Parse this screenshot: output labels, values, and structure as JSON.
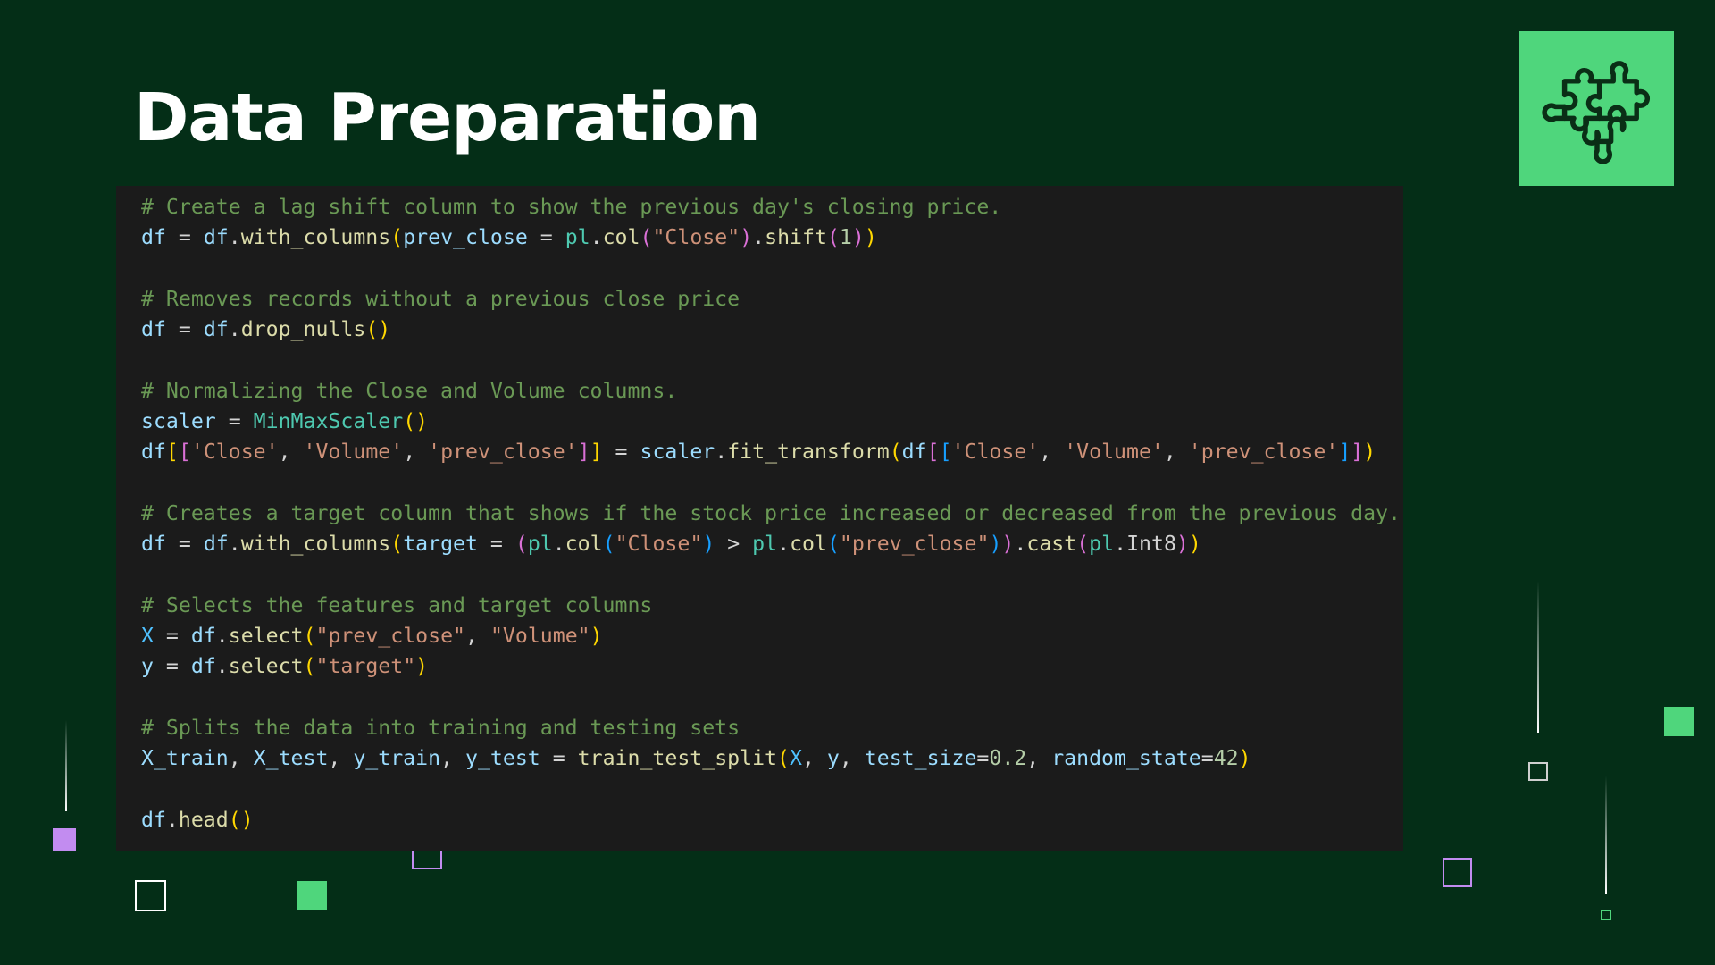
{
  "slide": {
    "title": "Data Preparation",
    "icon": "puzzle-pieces-icon"
  },
  "colors": {
    "background": "#042e17",
    "accent_green": "#4fd67c",
    "accent_purple": "#c28cf0",
    "code_bg": "#1b1b1b"
  },
  "code": {
    "language": "python",
    "lines": [
      [
        {
          "t": "# Create a lag shift column to show the previous day's closing price.",
          "k": "c"
        }
      ],
      [
        {
          "t": "df",
          "k": "v"
        },
        {
          "t": " = ",
          "k": "o"
        },
        {
          "t": "df",
          "k": "v"
        },
        {
          "t": ".",
          "k": "o"
        },
        {
          "t": "with_columns",
          "k": "f"
        },
        {
          "t": "(",
          "k": "b1"
        },
        {
          "t": "prev_close",
          "k": "v"
        },
        {
          "t": " = ",
          "k": "o"
        },
        {
          "t": "pl",
          "k": "cl"
        },
        {
          "t": ".",
          "k": "o"
        },
        {
          "t": "col",
          "k": "f"
        },
        {
          "t": "(",
          "k": "b2"
        },
        {
          "t": "\"Close\"",
          "k": "s"
        },
        {
          "t": ")",
          "k": "b2"
        },
        {
          "t": ".",
          "k": "o"
        },
        {
          "t": "shift",
          "k": "f"
        },
        {
          "t": "(",
          "k": "b2"
        },
        {
          "t": "1",
          "k": "n"
        },
        {
          "t": ")",
          "k": "b2"
        },
        {
          "t": ")",
          "k": "b1"
        }
      ],
      [],
      [
        {
          "t": "# Removes records without a previous close price",
          "k": "c"
        }
      ],
      [
        {
          "t": "df",
          "k": "v"
        },
        {
          "t": " = ",
          "k": "o"
        },
        {
          "t": "df",
          "k": "v"
        },
        {
          "t": ".",
          "k": "o"
        },
        {
          "t": "drop_nulls",
          "k": "f"
        },
        {
          "t": "()",
          "k": "b1"
        }
      ],
      [],
      [
        {
          "t": "# Normalizing the Close and Volume columns.",
          "k": "c"
        }
      ],
      [
        {
          "t": "scaler",
          "k": "v"
        },
        {
          "t": " = ",
          "k": "o"
        },
        {
          "t": "MinMaxScaler",
          "k": "cl"
        },
        {
          "t": "()",
          "k": "b1"
        }
      ],
      [
        {
          "t": "df",
          "k": "v"
        },
        {
          "t": "[",
          "k": "b1"
        },
        {
          "t": "[",
          "k": "b2"
        },
        {
          "t": "'Close'",
          "k": "s"
        },
        {
          "t": ", ",
          "k": "o"
        },
        {
          "t": "'Volume'",
          "k": "s"
        },
        {
          "t": ", ",
          "k": "o"
        },
        {
          "t": "'prev_close'",
          "k": "s"
        },
        {
          "t": "]",
          "k": "b2"
        },
        {
          "t": "]",
          "k": "b1"
        },
        {
          "t": " = ",
          "k": "o"
        },
        {
          "t": "scaler",
          "k": "v"
        },
        {
          "t": ".",
          "k": "o"
        },
        {
          "t": "fit_transform",
          "k": "f"
        },
        {
          "t": "(",
          "k": "b1"
        },
        {
          "t": "df",
          "k": "v"
        },
        {
          "t": "[",
          "k": "b2"
        },
        {
          "t": "[",
          "k": "b3"
        },
        {
          "t": "'Close'",
          "k": "s"
        },
        {
          "t": ", ",
          "k": "o"
        },
        {
          "t": "'Volume'",
          "k": "s"
        },
        {
          "t": ", ",
          "k": "o"
        },
        {
          "t": "'prev_close'",
          "k": "s"
        },
        {
          "t": "]",
          "k": "b3"
        },
        {
          "t": "]",
          "k": "b2"
        },
        {
          "t": ")",
          "k": "b1"
        }
      ],
      [],
      [
        {
          "t": "# Creates a target column that shows if the stock price increased or decreased from the previous day.",
          "k": "c"
        }
      ],
      [
        {
          "t": "df",
          "k": "v"
        },
        {
          "t": " = ",
          "k": "o"
        },
        {
          "t": "df",
          "k": "v"
        },
        {
          "t": ".",
          "k": "o"
        },
        {
          "t": "with_columns",
          "k": "f"
        },
        {
          "t": "(",
          "k": "b1"
        },
        {
          "t": "target",
          "k": "v"
        },
        {
          "t": " = ",
          "k": "o"
        },
        {
          "t": "(",
          "k": "b2"
        },
        {
          "t": "pl",
          "k": "cl"
        },
        {
          "t": ".",
          "k": "o"
        },
        {
          "t": "col",
          "k": "f"
        },
        {
          "t": "(",
          "k": "b3"
        },
        {
          "t": "\"Close\"",
          "k": "s"
        },
        {
          "t": ")",
          "k": "b3"
        },
        {
          "t": " > ",
          "k": "o"
        },
        {
          "t": "pl",
          "k": "cl"
        },
        {
          "t": ".",
          "k": "o"
        },
        {
          "t": "col",
          "k": "f"
        },
        {
          "t": "(",
          "k": "b3"
        },
        {
          "t": "\"prev_close\"",
          "k": "s"
        },
        {
          "t": ")",
          "k": "b3"
        },
        {
          "t": ")",
          "k": "b2"
        },
        {
          "t": ".",
          "k": "o"
        },
        {
          "t": "cast",
          "k": "f"
        },
        {
          "t": "(",
          "k": "b2"
        },
        {
          "t": "pl",
          "k": "cl"
        },
        {
          "t": ".",
          "k": "o"
        },
        {
          "t": "Int8",
          "k": "o"
        },
        {
          "t": ")",
          "k": "b2"
        },
        {
          "t": ")",
          "k": "b1"
        }
      ],
      [],
      [
        {
          "t": "# Selects the features and target columns",
          "k": "c"
        }
      ],
      [
        {
          "t": "X",
          "k": "x"
        },
        {
          "t": " = ",
          "k": "o"
        },
        {
          "t": "df",
          "k": "v"
        },
        {
          "t": ".",
          "k": "o"
        },
        {
          "t": "select",
          "k": "f"
        },
        {
          "t": "(",
          "k": "b1"
        },
        {
          "t": "\"prev_close\"",
          "k": "s"
        },
        {
          "t": ", ",
          "k": "o"
        },
        {
          "t": "\"Volume\"",
          "k": "s"
        },
        {
          "t": ")",
          "k": "b1"
        }
      ],
      [
        {
          "t": "y",
          "k": "v"
        },
        {
          "t": " = ",
          "k": "o"
        },
        {
          "t": "df",
          "k": "v"
        },
        {
          "t": ".",
          "k": "o"
        },
        {
          "t": "select",
          "k": "f"
        },
        {
          "t": "(",
          "k": "b1"
        },
        {
          "t": "\"target\"",
          "k": "s"
        },
        {
          "t": ")",
          "k": "b1"
        }
      ],
      [],
      [
        {
          "t": "# Splits the data into training and testing sets",
          "k": "c"
        }
      ],
      [
        {
          "t": "X_train",
          "k": "v"
        },
        {
          "t": ", ",
          "k": "o"
        },
        {
          "t": "X_test",
          "k": "v"
        },
        {
          "t": ", ",
          "k": "o"
        },
        {
          "t": "y_train",
          "k": "v"
        },
        {
          "t": ", ",
          "k": "o"
        },
        {
          "t": "y_test",
          "k": "v"
        },
        {
          "t": " = ",
          "k": "o"
        },
        {
          "t": "train_test_split",
          "k": "f"
        },
        {
          "t": "(",
          "k": "b1"
        },
        {
          "t": "X",
          "k": "x"
        },
        {
          "t": ", ",
          "k": "o"
        },
        {
          "t": "y",
          "k": "v"
        },
        {
          "t": ", ",
          "k": "o"
        },
        {
          "t": "test_size",
          "k": "v"
        },
        {
          "t": "=",
          "k": "o"
        },
        {
          "t": "0.2",
          "k": "n"
        },
        {
          "t": ", ",
          "k": "o"
        },
        {
          "t": "random_state",
          "k": "v"
        },
        {
          "t": "=",
          "k": "o"
        },
        {
          "t": "42",
          "k": "n"
        },
        {
          "t": ")",
          "k": "b1"
        }
      ],
      [],
      [
        {
          "t": "df",
          "k": "v"
        },
        {
          "t": ".",
          "k": "o"
        },
        {
          "t": "head",
          "k": "f"
        },
        {
          "t": "()",
          "k": "b1"
        }
      ]
    ]
  }
}
